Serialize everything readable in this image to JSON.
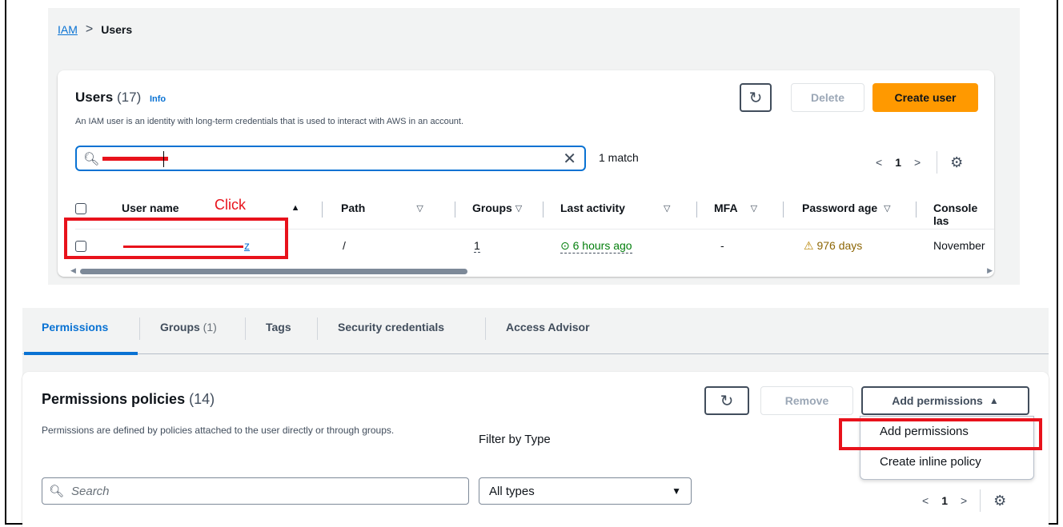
{
  "breadcrumb": {
    "root": "IAM",
    "separator": ">",
    "current": "Users"
  },
  "users_panel": {
    "title": "Users",
    "count": "(17)",
    "info": "Info",
    "description": "An IAM user is an identity with long-term credentials that is used to interact with AWS in an account.",
    "refresh_icon": "refresh-icon",
    "delete_label": "Delete",
    "create_label": "Create user",
    "search": {
      "match_text": "1 match",
      "clear_icon": "close-icon"
    },
    "pagination": {
      "page": "1",
      "prev": "<",
      "next": ">"
    },
    "columns": [
      {
        "label": "User name",
        "sort": "▲"
      },
      {
        "label": "Path",
        "sort": "▽"
      },
      {
        "label": "Groups",
        "sort": "▽"
      },
      {
        "label": "Last activity",
        "sort": "▽"
      },
      {
        "label": "MFA",
        "sort": "▽"
      },
      {
        "label": "Password age",
        "sort": "▽"
      },
      {
        "label": "Console las"
      }
    ],
    "rows": [
      {
        "user_name_suffix": "z",
        "path": "/",
        "groups": "1",
        "last_activity": "6 hours ago",
        "mfa": "-",
        "password_age": "976 days",
        "console_last": "November"
      }
    ],
    "annotation": "Click"
  },
  "detail_panel": {
    "tabs": [
      {
        "label": "Permissions",
        "count": "",
        "active": true
      },
      {
        "label": "Groups",
        "count": "(1)"
      },
      {
        "label": "Tags",
        "count": ""
      },
      {
        "label": "Security credentials",
        "count": ""
      },
      {
        "label": "Access Advisor",
        "count": ""
      }
    ],
    "permissions": {
      "title": "Permissions policies",
      "count": "(14)",
      "description": "Permissions are defined by policies attached to the user directly or through groups.",
      "remove_label": "Remove",
      "add_label": "Add permissions",
      "add_caret": "▲",
      "menu": [
        "Add permissions",
        "Create inline policy"
      ],
      "filter_label": "Filter by Type",
      "search_placeholder": "Search",
      "type_value": "All types",
      "pagination": {
        "page": "1",
        "prev": "<",
        "next": ">"
      }
    }
  },
  "colors": {
    "accent": "#0972d3",
    "primary": "#ff9900",
    "annotation": "#e8121b",
    "success": "#037f0c",
    "warning": "#8d6605"
  }
}
